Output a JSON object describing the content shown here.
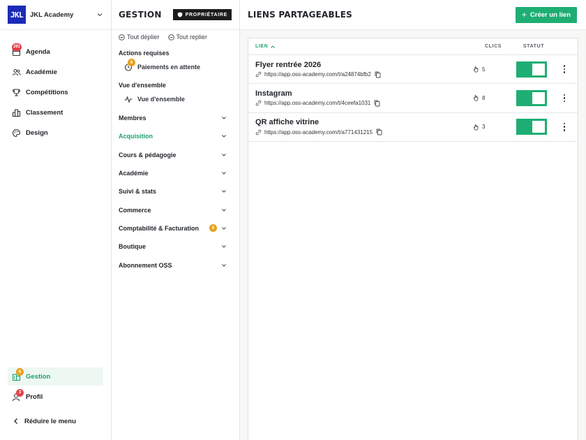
{
  "sidebar": {
    "org_logo": "JKL",
    "org_name": "JKL Academy",
    "items": [
      {
        "label": "Agenda",
        "icon": "calendar-icon",
        "badge": "281"
      },
      {
        "label": "Académie",
        "icon": "users-icon"
      },
      {
        "label": "Compétitions",
        "icon": "trophy-icon"
      },
      {
        "label": "Classement",
        "icon": "ranking-icon"
      },
      {
        "label": "Design",
        "icon": "palette-icon"
      }
    ],
    "bottom": [
      {
        "label": "Gestion",
        "icon": "building-icon",
        "badge": "6",
        "active": true
      },
      {
        "label": "Profil",
        "icon": "user-icon",
        "badge": "3"
      }
    ],
    "collapse_label": "Réduire le menu"
  },
  "panel": {
    "title": "GESTION",
    "owner_badge": "PROPRIÉTAIRE",
    "expand_all": "Tout déplier",
    "collapse_all": "Tout replier",
    "actions_title": "Actions requises",
    "pending_payments": {
      "label": "Paiements en attente",
      "badge": "6"
    },
    "overview_title": "Vue d'ensemble",
    "overview_item": "Vue d'ensemble",
    "sections": [
      {
        "label": "Membres"
      },
      {
        "label": "Acquisition",
        "active": true
      },
      {
        "label": "Cours & pédagogie"
      },
      {
        "label": "Académie"
      },
      {
        "label": "Suivi & stats"
      },
      {
        "label": "Commerce"
      },
      {
        "label": "Comptabilité & Facturation",
        "count": "6"
      },
      {
        "label": "Boutique"
      },
      {
        "label": "Abonnement OSS"
      }
    ]
  },
  "main": {
    "title": "LIENS PARTAGEABLES",
    "create_button": "Créer un lien",
    "columns": {
      "link": "LIEN",
      "clicks": "CLICS",
      "status": "STATUT"
    },
    "rows": [
      {
        "name": "Flyer rentrée 2026",
        "url": "https://app.oss-academy.com/t/a24874bfb2",
        "clicks": "5",
        "active": true
      },
      {
        "name": "Instagram",
        "url": "https://app.oss-academy.com/t/4ceefa1031",
        "clicks": "8",
        "active": true
      },
      {
        "name": "QR affiche vitrine",
        "url": "https://app.oss-academy.com/t/a771431215",
        "clicks": "3",
        "active": true
      }
    ]
  },
  "colors": {
    "accent": "#1eae73",
    "badge_red": "#e2424a",
    "badge_orange": "#e8a21b",
    "logo": "#1b2bb8"
  }
}
